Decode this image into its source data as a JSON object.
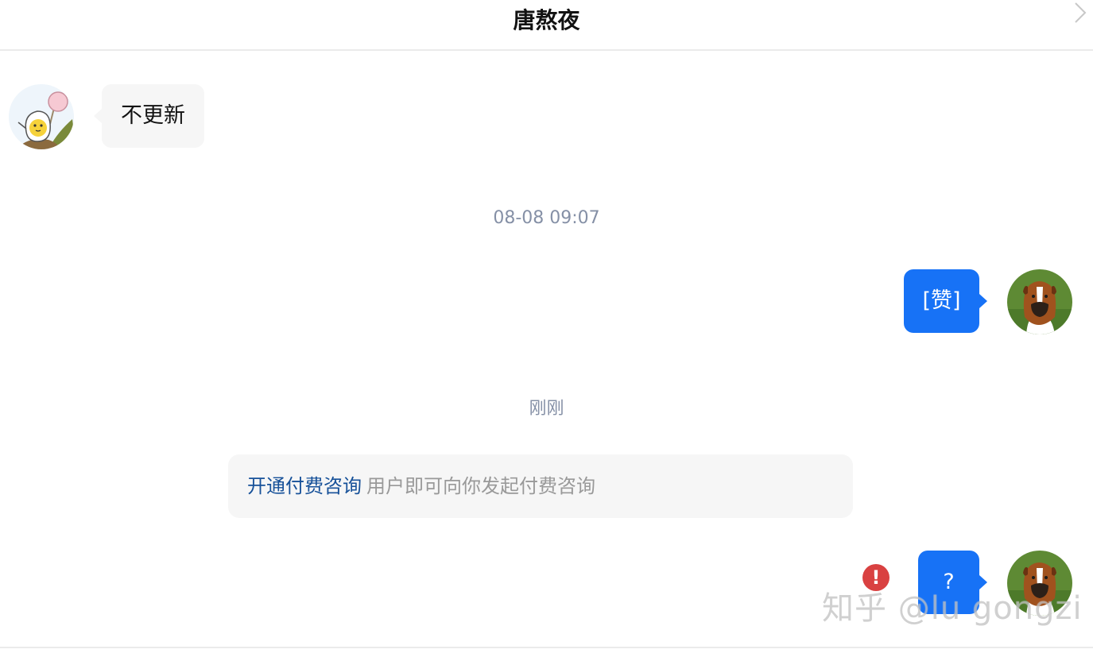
{
  "header": {
    "title": "唐熬夜"
  },
  "messages": {
    "incoming_text": "不更新",
    "timestamp_1": "08-08 09:07",
    "outgoing_1": "[赞]",
    "timestamp_2": "刚刚",
    "outgoing_2": "?"
  },
  "consult": {
    "link_label": "开通付费咨询",
    "description": "用户即可向你发起付费咨询"
  },
  "watermark": "知乎 @lu gongzi",
  "icons": {
    "close": "chevron-right-icon",
    "error": "exclamation-icon"
  },
  "colors": {
    "accent": "#1772f6",
    "link": "#175199",
    "error": "#d94141"
  }
}
